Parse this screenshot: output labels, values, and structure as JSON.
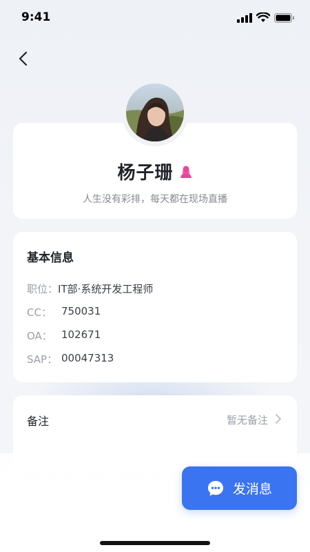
{
  "status_bar": {
    "time": "9:41"
  },
  "profile": {
    "name": "杨子珊",
    "bio": "人生没有彩排，每天都在现场直播",
    "gender_icon": "female-person-icon",
    "gender_color": "#e8479a"
  },
  "info": {
    "title": "基本信息",
    "rows": [
      {
        "label": "职位：",
        "value": "IT部·系统开发工程师"
      },
      {
        "label": "CC：",
        "value": "750031"
      },
      {
        "label": "OA：",
        "value": "102671"
      },
      {
        "label": "SAP：",
        "value": "00047313"
      }
    ]
  },
  "remark": {
    "label": "备注",
    "value": "暂无备注"
  },
  "action": {
    "send_label": "发消息",
    "accent": "#3b74f1"
  }
}
